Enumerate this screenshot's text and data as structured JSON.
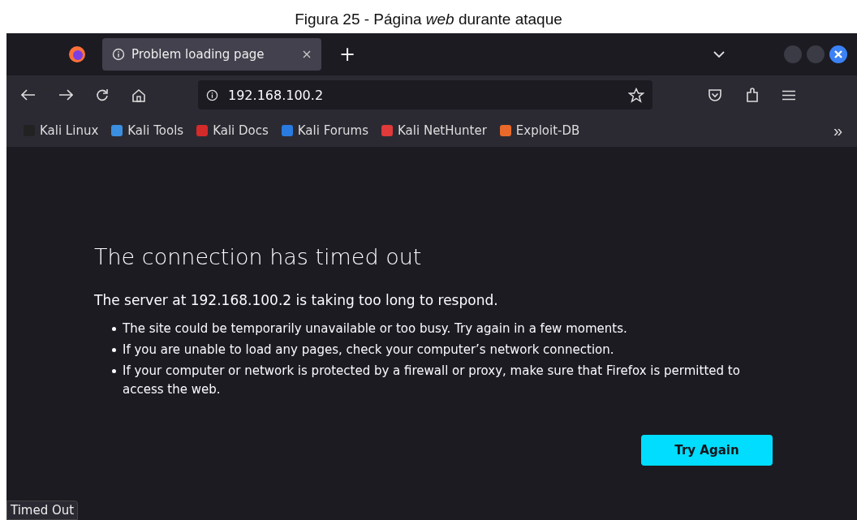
{
  "caption": "Figura 25 - Página *web* durante ataque",
  "tabs": [
    {
      "label": "Problem loading page",
      "selected": true
    }
  ],
  "new_tab": "+",
  "address_bar": {
    "value": "192.168.100.2"
  },
  "bookmarks": [
    {
      "label": "Kali Linux",
      "color": "#222222"
    },
    {
      "label": "Kali Tools",
      "color": "#3a8fe0"
    },
    {
      "label": "Kali Docs",
      "color": "#d42a2a"
    },
    {
      "label": "Kali Forums",
      "color": "#2a7be0"
    },
    {
      "label": "Kali NetHunter",
      "color": "#e03a3a"
    },
    {
      "label": "Exploit-DB",
      "color": "#e8692a"
    }
  ],
  "bookmarks_overflow": "»",
  "error": {
    "title": "The connection has timed out",
    "subtitle": "The server at 192.168.100.2 is taking too long to respond.",
    "bullets": [
      "The site could be temporarily unavailable or too busy. Try again in a few moments.",
      "If you are unable to load any pages, check your computer’s network connection.",
      "If your computer or network is protected by a firewall or proxy, make sure that Firefox is permitted to access the web."
    ],
    "button": "Try Again"
  },
  "status_bar": "Timed Out"
}
